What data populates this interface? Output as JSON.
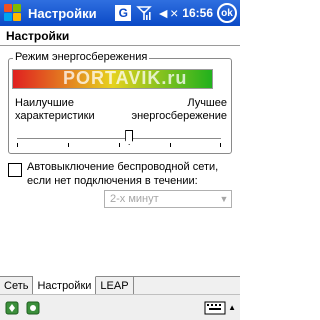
{
  "titlebar": {
    "app_title": "Настройки",
    "g_label": "G",
    "clock": "16:56",
    "ok_label": "ok",
    "volume_glyph": "◄×"
  },
  "page_heading": "Настройки",
  "power_group": {
    "legend": "Режим энергосбережения",
    "watermark": "PORTAVIK.ru",
    "left_label_line1": "Наилучшие",
    "left_label_line2": "характеристики",
    "right_label_line1": "Лучшее",
    "right_label_line2": "энергосбережение",
    "slider_level_percent": 55
  },
  "auto_off": {
    "label": "Автовыключение беспроводной сети, если нет подключения в течении:",
    "checked": false,
    "dropdown_value": "2-х минут"
  },
  "tabs": [
    {
      "label": "Сеть"
    },
    {
      "label": "Настройки"
    },
    {
      "label": "LEAP"
    }
  ],
  "colors": {
    "titlebar": "#0a49c6",
    "bar_red": "#e02020",
    "bar_yellow": "#e6d21f",
    "bar_green": "#21b11d"
  }
}
